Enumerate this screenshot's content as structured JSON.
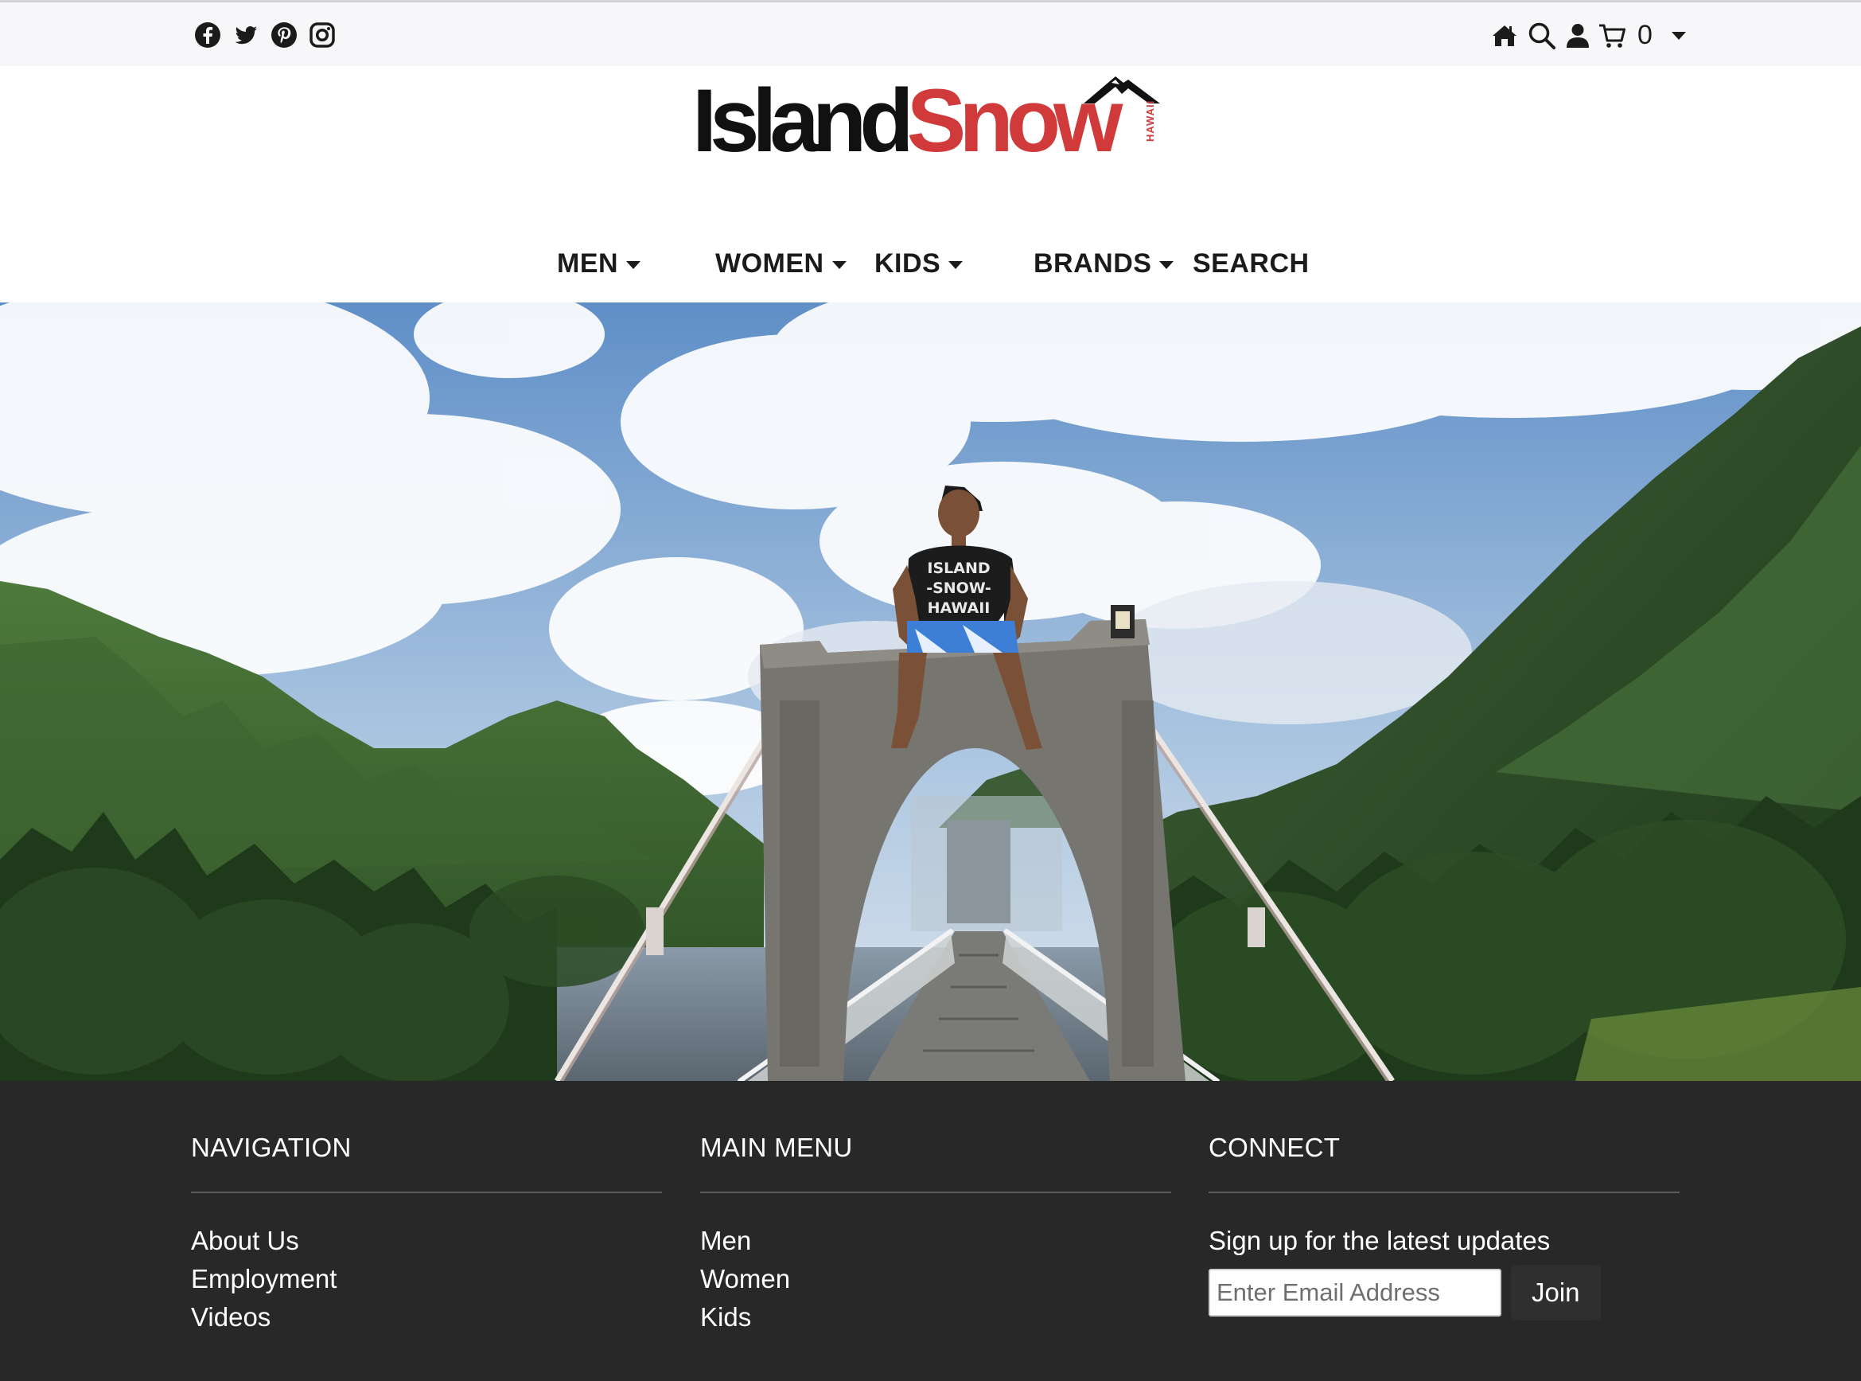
{
  "social": {
    "icons": [
      "facebook-icon",
      "twitter-icon",
      "pinterest-icon",
      "instagram-icon"
    ]
  },
  "utility": {
    "icons": [
      "home-icon",
      "search-icon",
      "user-icon",
      "cart-icon"
    ],
    "cart_count": "0"
  },
  "logo": {
    "word1": "Island",
    "word2": "Snow",
    "tagline": "HAWAII",
    "colors": {
      "island": "#111111",
      "snow": "#d13a3a"
    }
  },
  "nav": {
    "items": [
      {
        "label": "MEN",
        "dropdown": true
      },
      {
        "label": "WOMEN",
        "dropdown": true
      },
      {
        "label": "KIDS",
        "dropdown": true
      },
      {
        "label": "BRANDS",
        "dropdown": true
      },
      {
        "label": "SEARCH",
        "dropdown": false
      }
    ]
  },
  "hero": {
    "shirt_text": [
      "ISLAND",
      "-SNOW-",
      "HAWAII"
    ]
  },
  "footer": {
    "navigation": {
      "title": "NAVIGATION",
      "links": [
        "About Us",
        "Employment",
        "Videos"
      ]
    },
    "main_menu": {
      "title": "MAIN MENU",
      "links": [
        "Men",
        "Women",
        "Kids"
      ]
    },
    "connect": {
      "title": "CONNECT",
      "signup_text": "Sign up for the latest updates",
      "email_placeholder": "Enter Email Address",
      "email_value": "",
      "join_label": "Join"
    },
    "colors": {
      "background": "#282828",
      "text": "#ffffff"
    }
  }
}
